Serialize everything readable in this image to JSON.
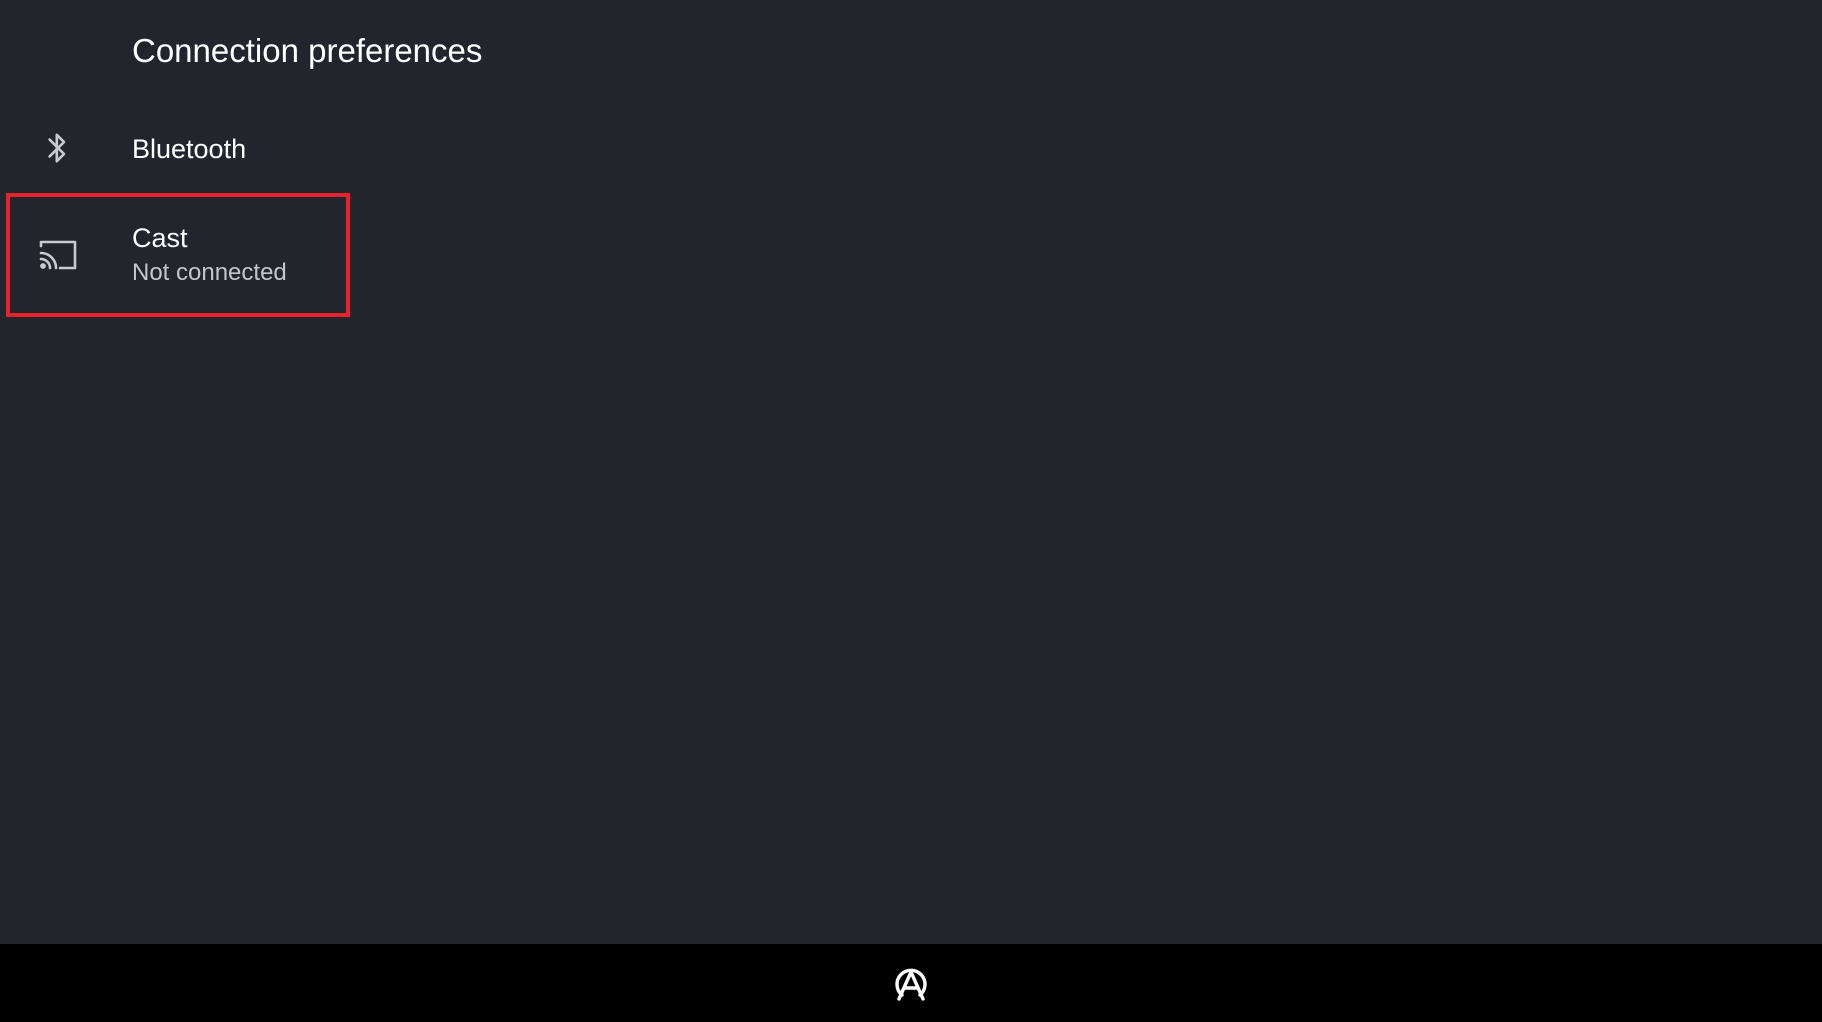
{
  "header": {
    "title": "Connection preferences"
  },
  "items": [
    {
      "id": "bluetooth",
      "title": "Bluetooth",
      "icon": "bluetooth-icon"
    },
    {
      "id": "cast",
      "title": "Cast",
      "summary": "Not connected",
      "icon": "cast-icon",
      "focused": true
    }
  ],
  "focus_color": "#e8212b",
  "nav_bar": {
    "icon": "launcher-logo-icon"
  }
}
